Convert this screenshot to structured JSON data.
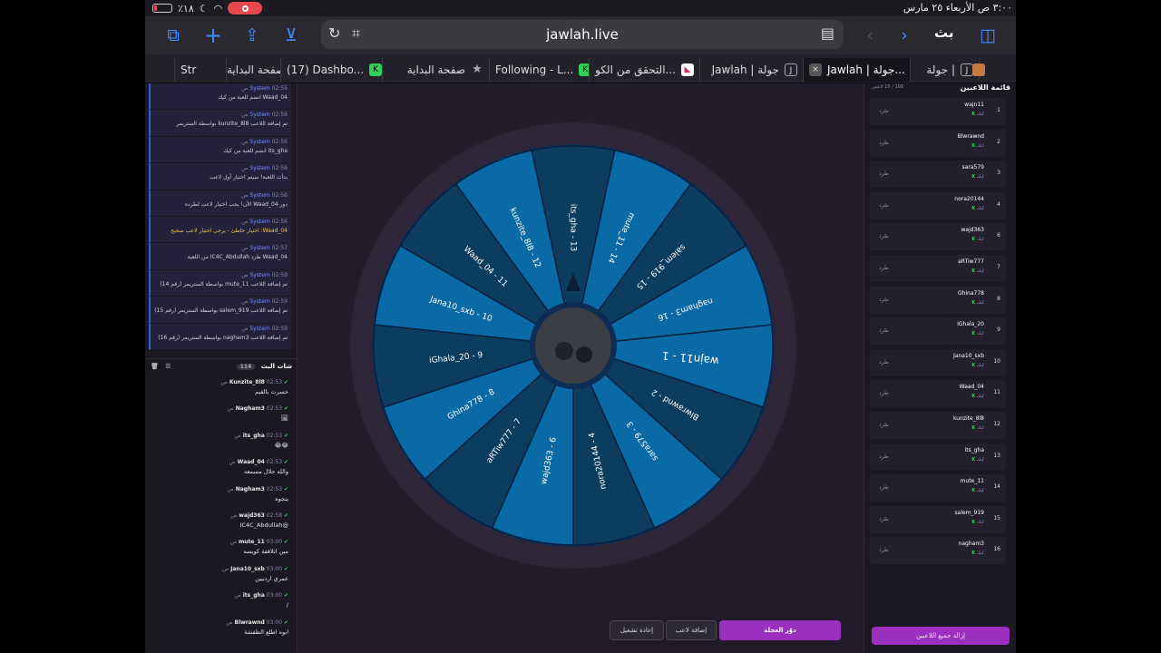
{
  "status_bar": {
    "time_date": "٣:٠٠ ص   الأربعاء ٢٥ مارس",
    "battery_percent": "٪١٨"
  },
  "toolbar": {
    "url": "jawlah.live",
    "broadcast_label": "بث"
  },
  "tabs": [
    {
      "label": "Str",
      "favicon": ""
    },
    {
      "label": "صفحة البداية",
      "favicon": ""
    },
    {
      "label": "(17) Dashbo...",
      "favicon": "kick"
    },
    {
      "label": "صفحة البداية",
      "favicon": "star"
    },
    {
      "label": "Following - L...",
      "favicon": "kick"
    },
    {
      "label": "التحقق من الكو...",
      "favicon": "red"
    },
    {
      "label": "Jawlah | جولة",
      "favicon": "J"
    },
    {
      "label": "Jawlah | جولة...",
      "favicon": "J",
      "active": true
    },
    {
      "label": "جولة |",
      "favicon": "J"
    }
  ],
  "system_messages": [
    {
      "time": "02:55 ص",
      "sender": "System",
      "text": "Waad_04 انضم للعبة من كيك"
    },
    {
      "time": "02:56 ص",
      "sender": "System",
      "text": "تم إضافة اللاعب kunzite_8l8 بواسطة الستريمر"
    },
    {
      "time": "02:56 ص",
      "sender": "System",
      "text": "its_gha انضم للعبة من كيك"
    },
    {
      "time": "02:56 ص",
      "sender": "System",
      "text": "بدأت اللعبة! سيتم اختيار أول لاعب"
    },
    {
      "time": "02:56 ص",
      "sender": "System",
      "text": "دور Waad_04 الآن! يجب اختيار لاعب لطرده"
    },
    {
      "time": "02:56 ص",
      "sender": "System",
      "text": "Waad_04: اختيار خاطئ - يرجى اختيار لاعب صحيح",
      "warn": true
    },
    {
      "time": "02:57 ص",
      "sender": "System",
      "text": "Waad_04 طرد IC4C_Abdullah من اللعبة"
    },
    {
      "time": "02:59 ص",
      "sender": "System",
      "text": "تم إضافة اللاعب mute_11 بواسطة الستريمر (رقم 14)"
    },
    {
      "time": "02:59 ص",
      "sender": "System",
      "text": "تم إضافة اللاعب salem_919 بواسطة الستريمر (رقم 15)"
    },
    {
      "time": "02:59 ص",
      "sender": "System",
      "text": "تم إضافة اللاعب nagham3 بواسطة الستريمر (رقم 16)"
    }
  ],
  "chat": {
    "title": "شات البث",
    "count": "114",
    "messages": [
      {
        "name": "Kunzite_8l8",
        "time": "02:53 ص",
        "text": "خسرت بالقيم"
      },
      {
        "name": "Nagham3",
        "time": "02:53 ص",
        "text": "🖼"
      },
      {
        "name": "its_gha",
        "time": "02:53 ص",
        "text": "😂😂"
      },
      {
        "name": "Waad_04",
        "time": "02:53 ص",
        "text": "والله حلال مسمعه"
      },
      {
        "name": "Nagham3",
        "time": "02:53 ص",
        "text": "ينجوه"
      },
      {
        "name": "wajd363",
        "time": "02:58 ص",
        "text": "@IC4C_Abdullah"
      },
      {
        "name": "mute_11",
        "time": "03:00 ص",
        "text": "مين اتلاقفة كويسه"
      },
      {
        "name": "Jana10_sxb",
        "time": "03:00 ص",
        "text": "عمري اردنيين"
      },
      {
        "name": "its_gha",
        "time": "03:00 ص",
        "text": "/"
      },
      {
        "name": "Blwrawnd",
        "time": "03:00 ص",
        "text": "ابوه اطلع الطفشة"
      }
    ]
  },
  "wheel": {
    "segments": [
      "wajn11 - 1",
      "Blwrawnd - 2",
      "sara579 - 3",
      "nora20144 - 4",
      "wajd363 - 6",
      "aRTiw777 - 7",
      "Ghina778 - 8",
      "iGhala_20 - 9",
      "Jana10_sxb - 10",
      "Waad_04 - 11",
      "kunzite_8l8 - 12",
      "its_gha - 13",
      "mute_11 - 14",
      "salem_919 - 15",
      "nagham3 - 16"
    ],
    "colors": [
      "#0a6aa6",
      "#0c3d5e"
    ]
  },
  "buttons": {
    "restart": "إعادة تشغيل",
    "add_player": "إضافة لاعب",
    "spin": "دوّر العجلة",
    "clear_players": "إزالة جميع اللاعبين"
  },
  "players": {
    "title": "قائمة اللاعبين",
    "count_text": "100 / 15 لاعبين",
    "kick_label": "طرد",
    "source_label": "كيك",
    "list": [
      {
        "num": "1",
        "name": "wajn11"
      },
      {
        "num": "2",
        "name": "Blwrawnd"
      },
      {
        "num": "3",
        "name": "sara579"
      },
      {
        "num": "4",
        "name": "nora20144"
      },
      {
        "num": "6",
        "name": "wajd363"
      },
      {
        "num": "7",
        "name": "aRTiw777"
      },
      {
        "num": "8",
        "name": "Ghina778"
      },
      {
        "num": "9",
        "name": "iGhala_20"
      },
      {
        "num": "10",
        "name": "Jana10_sxb"
      },
      {
        "num": "11",
        "name": "Waad_04"
      },
      {
        "num": "12",
        "name": "kunzite_8l8"
      },
      {
        "num": "13",
        "name": "its_gha"
      },
      {
        "num": "14",
        "name": "mute_11"
      },
      {
        "num": "15",
        "name": "salem_919"
      },
      {
        "num": "16",
        "name": "nagham3"
      }
    ]
  }
}
